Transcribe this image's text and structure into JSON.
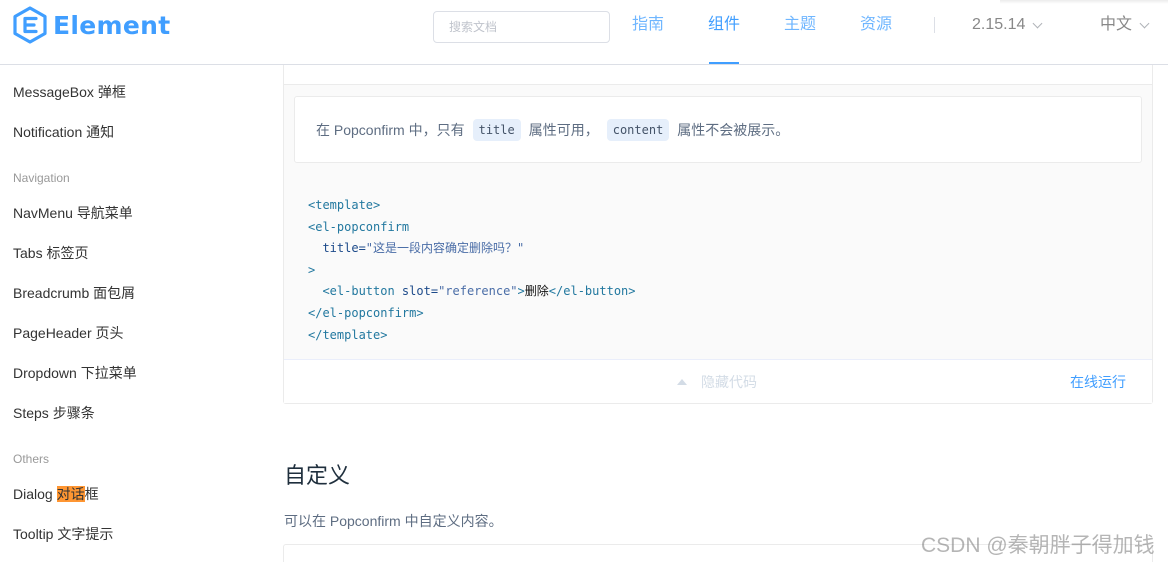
{
  "brand": {
    "logo_text": "Element",
    "accent": "#409eff"
  },
  "header": {
    "search_placeholder": "搜索文档",
    "nav": [
      "指南",
      "组件",
      "主题",
      "资源"
    ],
    "active_nav": "组件",
    "version": "2.15.14",
    "language": "中文"
  },
  "sidebar": {
    "items_top": [
      "MessageBox 弹框",
      "Notification 通知"
    ],
    "group_navigation": "Navigation",
    "navigation_items": [
      "NavMenu 导航菜单",
      "Tabs 标签页",
      "Breadcrumb 面包屑",
      "PageHeader 页头",
      "Dropdown 下拉菜单",
      "Steps 步骤条"
    ],
    "group_others": "Others",
    "dialog_prefix": "Dialog ",
    "dialog_highlight": "对话",
    "dialog_suffix": "框",
    "tooltip": "Tooltip 文字提示"
  },
  "demo": {
    "tip_part1": "在 Popconfirm 中，只有",
    "tip_code1": "title",
    "tip_part2": "属性可用，",
    "tip_code2": "content",
    "tip_part3": "属性不会被展示。",
    "code": {
      "l1": "<template>",
      "l2": "<el-popconfirm",
      "l3_attr": "  title=",
      "l3_str": "\"这是一段内容确定删除吗？\"",
      "l4": ">",
      "l5_tag": "  <el-button",
      "l5_attr": " slot=",
      "l5_str": "\"reference\"",
      "l5_close": ">",
      "l5_text": "删除",
      "l5_end": "</el-button>",
      "l6": "</el-popconfirm>",
      "l7": "</template>"
    },
    "hide_code": "隐藏代码",
    "run_online": "在线运行"
  },
  "section": {
    "title": "自定义",
    "description": "可以在 Popconfirm 中自定义内容。"
  },
  "watermark": "CSDN @秦朝胖子得加钱"
}
